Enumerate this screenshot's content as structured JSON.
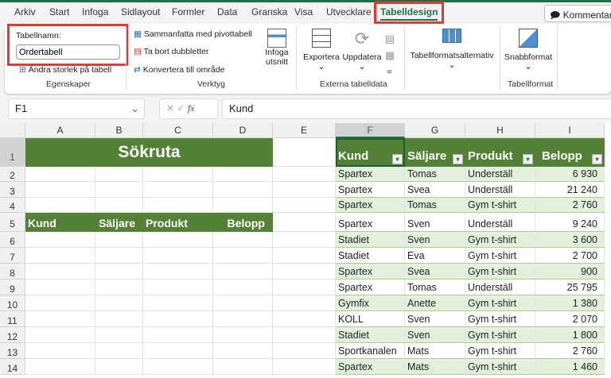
{
  "tabs": [
    "Arkiv",
    "Start",
    "Infoga",
    "Sidlayout",
    "Formler",
    "Data",
    "Granska",
    "Visa",
    "Utvecklare",
    "Tabelldesign"
  ],
  "active_tab": "Tabelldesign",
  "comment_button": "Kommentare",
  "ribbon": {
    "table_name_label": "Tabellnamn:",
    "table_name_value": "Ordertabell",
    "resize_table": "Ändra storlek på tabell",
    "group_properties": "Egenskaper",
    "pivot": "Sammanfatta med pivottabell",
    "remove_duplicates": "Ta bort dubbletter",
    "convert_range": "Konvertera till område",
    "insert_slicer_1": "Infoga",
    "insert_slicer_2": "utsnitt",
    "group_tools": "Verktyg",
    "export": "Exportera",
    "refresh": "Uppdatera",
    "group_external": "Externa tabelldata",
    "style_options": "Tabellformatsalternativ",
    "quick_styles": "Snabbformat",
    "group_styles": "Tabellformat"
  },
  "formula_bar": {
    "name_box": "F1",
    "formula": "Kund",
    "fx": "fx"
  },
  "columns": [
    "A",
    "B",
    "C",
    "D",
    "E",
    "F",
    "G",
    "H",
    "I"
  ],
  "rows": [
    "1",
    "2",
    "3",
    "4",
    "5",
    "6",
    "7",
    "8",
    "9",
    "10",
    "11",
    "12",
    "13",
    "14"
  ],
  "search_box": {
    "title": "Sökruta",
    "headers": [
      "Kund",
      "Säljare",
      "Produkt",
      "Belopp"
    ]
  },
  "table": {
    "headers": [
      "Kund",
      "Säljare",
      "Produkt",
      "Belopp"
    ],
    "data": [
      [
        "Spartex",
        "Tomas",
        "Underställ",
        "6 930"
      ],
      [
        "Spartex",
        "Svea",
        "Underställ",
        "21 240"
      ],
      [
        "Spartex",
        "Tomas",
        "Gym t-shirt",
        "2 760"
      ],
      [
        "Spartex",
        "Sven",
        "Underställ",
        "9 240"
      ],
      [
        "Stadiet",
        "Sven",
        "Gym t-shirt",
        "3 600"
      ],
      [
        "Stadiet",
        "Eva",
        "Gym t-shirt",
        "2 700"
      ],
      [
        "Spartex",
        "Svea",
        "Gym t-shirt",
        "900"
      ],
      [
        "Spartex",
        "Tomas",
        "Underställ",
        "25 795"
      ],
      [
        "Gymfix",
        "Anette",
        "Gym t-shirt",
        "1 380"
      ],
      [
        "KOLL",
        "Sven",
        "Gym t-shirt",
        "2 070"
      ],
      [
        "Stadiet",
        "Sven",
        "Gym t-shirt",
        "1 800"
      ],
      [
        "Sportkanalen",
        "Mats",
        "Gym t-shirt",
        "2 760"
      ],
      [
        "Spartex",
        "Mats",
        "Gym t-shirt",
        "1 460"
      ]
    ]
  },
  "colors": {
    "header_green": "#538135",
    "band_green": "#e2efda",
    "accent": "#1e7145",
    "highlight_red": "#e53935"
  }
}
